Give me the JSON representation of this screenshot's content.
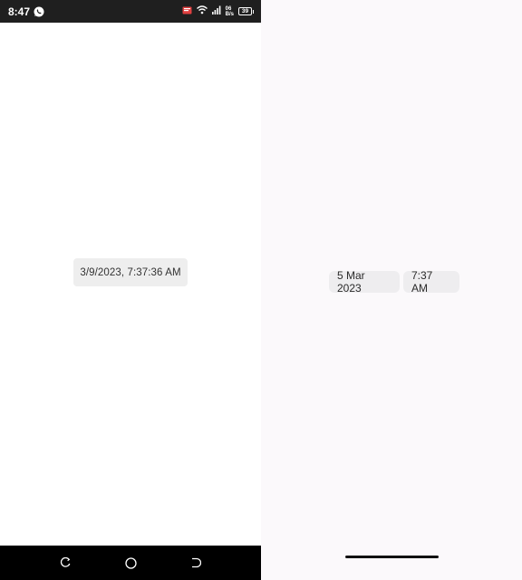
{
  "android": {
    "status_bar": {
      "time": "8:47",
      "left_icons": [
        "whatsapp-icon"
      ],
      "right_icons": [
        "cast-icon",
        "wifi-icon",
        "signal-icon",
        "network-speed-icon",
        "battery-icon"
      ],
      "network_speed_top": "06",
      "network_speed_bottom": "B/s",
      "battery_level": "39"
    },
    "datetime_display": "3/9/2023, 7:37:36 AM",
    "nav_bar": {
      "buttons": [
        "recent-apps-icon",
        "home-icon",
        "back-icon"
      ]
    }
  },
  "ios": {
    "date_picker": "5 Mar 2023",
    "time_picker": "7:37 AM"
  }
}
